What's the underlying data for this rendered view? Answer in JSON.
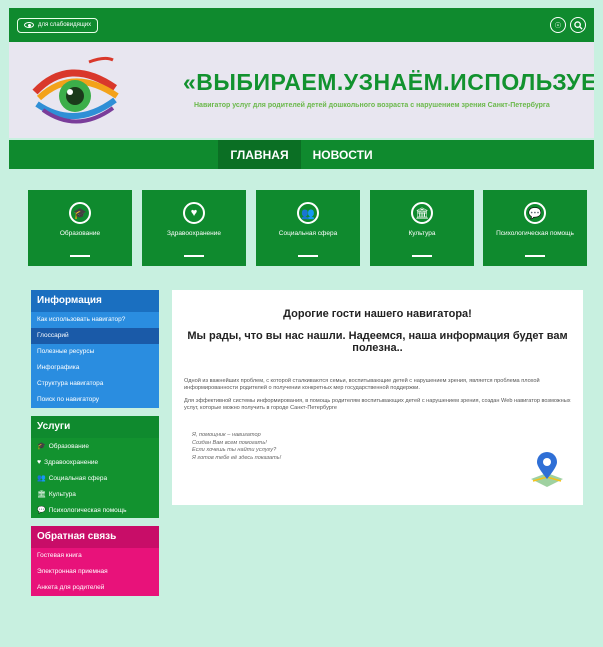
{
  "topbar": {
    "vision_label": "для слабовидящих",
    "icons": [
      "accessibility-icon",
      "search-icon"
    ]
  },
  "header": {
    "title": "«ВЫБИРАЕМ.УЗНАЁМ.ИСПОЛЬЗУЕМ»",
    "subtitle": "Навигатор услуг для родителей детей дошкольного возраста с нарушением зрения Санкт-Петербурга"
  },
  "nav": {
    "items": [
      {
        "label": "ГЛАВНАЯ",
        "active": true
      },
      {
        "label": "НОВОСТИ",
        "active": false
      }
    ]
  },
  "tiles": [
    {
      "label": "Образование",
      "icon": "graduation-cap-icon",
      "glyph": "🎓"
    },
    {
      "label": "Здравоохранение",
      "icon": "heart-pulse-icon",
      "glyph": "♥"
    },
    {
      "label": "Социальная сфера",
      "icon": "people-icon",
      "glyph": "👥"
    },
    {
      "label": "Культура",
      "icon": "museum-icon",
      "glyph": "🏛"
    },
    {
      "label": "Психологическая помощь",
      "icon": "chat-icon",
      "glyph": "💬"
    }
  ],
  "sidebar": {
    "info": {
      "title": "Информация",
      "items": [
        "Как использовать навигатор?",
        "Глоссарий",
        "Полезные ресурсы",
        "Инфографика",
        "Структура навигатора",
        "Поиск по навигатору"
      ],
      "selected_index": 1
    },
    "services": {
      "title": "Услуги",
      "items": [
        {
          "label": "Образование",
          "glyph": "🎓"
        },
        {
          "label": "Здравоохранение",
          "glyph": "♥"
        },
        {
          "label": "Социальная сфера",
          "glyph": "👥"
        },
        {
          "label": "Культура",
          "glyph": "🏛"
        },
        {
          "label": "Психологическая помощь",
          "glyph": "💬"
        }
      ]
    },
    "feedback": {
      "title": "Обратная связь",
      "items": [
        "Гостевая книга",
        "Электронная приемная",
        "Анкета для родителей"
      ]
    }
  },
  "main": {
    "heading1": "Дорогие гости нашего навигатора!",
    "heading2": "Мы рады, что вы нас нашли. Надеемся, наша информация будет вам полезна..",
    "paragraph1": "Одной из важнейших проблем, с которой сталкиваются семьи, воспитывающие детей с нарушением зрения, является проблема плохой информированности родителей о получении конкретных мер государственной поддержки.",
    "paragraph2": "Для эффективной системы информирования, в помощь родителям воспитывающих детей с нарушением зрения, создан Web навигатор возможных услуг, которые можно получить в городе Санкт-Петербурге",
    "poem": [
      "Я, помощник – навигатор",
      "Создан Вам всем помогать!",
      "Если хочешь ты найти услугу?",
      "Я готов тебе её здесь показать!"
    ]
  },
  "colors": {
    "green": "#0f8a2e",
    "blue": "#2a8de0",
    "pink": "#e8127a",
    "background": "#c8f0e0"
  }
}
